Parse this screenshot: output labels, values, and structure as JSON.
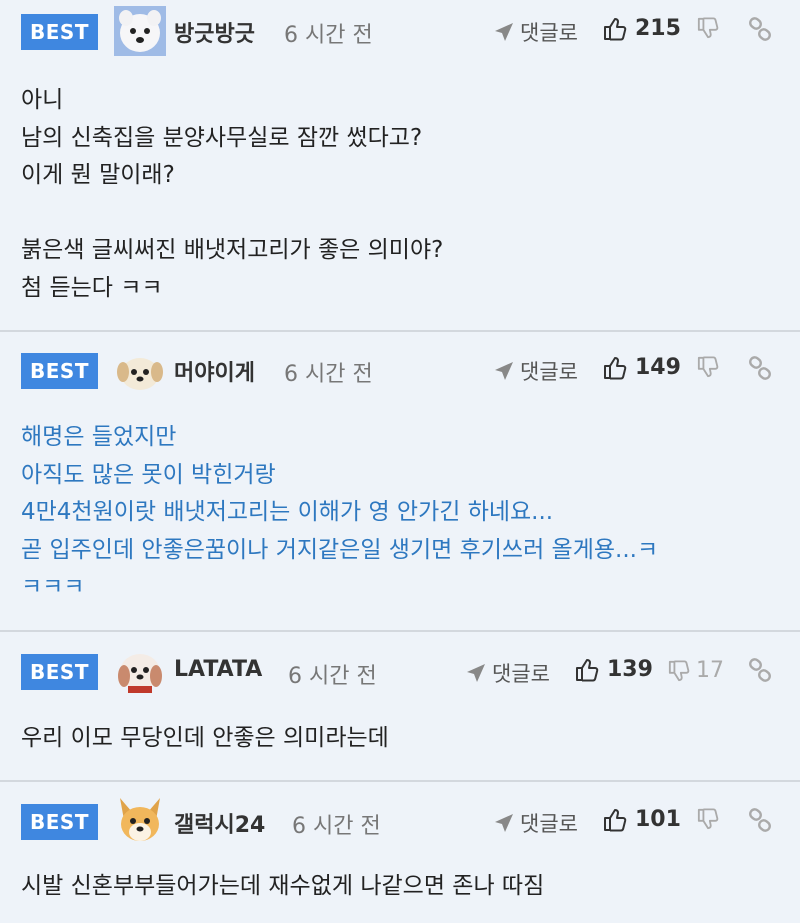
{
  "comments": [
    {
      "badge": "BEST",
      "nickname": "방긋방긋",
      "time": "6 시간 전",
      "reply_label": "댓글로",
      "likes": "215",
      "dislikes": "",
      "highlight": false,
      "avatar": "white-dog-avatar",
      "text": "아니\n남의 신축집을 분양사무실로 잠깐 썼다고?\n이게 뭔 말이래?\n\n붉은색 글씨써진 배냇저고리가 좋은 의미야?\n첨 듣는다 ㅋㅋ"
    },
    {
      "badge": "BEST",
      "nickname": "머야이게",
      "time": "6 시간 전",
      "reply_label": "댓글로",
      "likes": "149",
      "dislikes": "",
      "highlight": true,
      "avatar": "puppy-avatar",
      "text": "해명은 들었지만\n아직도 많은 못이 박힌거랑\n4만4천원이랏 배냇저고리는 이해가 영 안가긴 하네요...\n곧 입주인데 안좋은꿈이나 거지같은일 생기면 후기쓰러 올게용...ㅋ\nㅋㅋㅋ"
    },
    {
      "badge": "BEST",
      "nickname": "LATATA",
      "time": "6 시간 전",
      "reply_label": "댓글로",
      "likes": "139",
      "dislikes": "17",
      "highlight": false,
      "avatar": "small-dog-avatar",
      "text": "우리 이모 무당인데 안좋은 의미라는데"
    },
    {
      "badge": "BEST",
      "nickname": "갤럭시24",
      "time": "6 시간 전",
      "reply_label": "댓글로",
      "likes": "101",
      "dislikes": "",
      "highlight": false,
      "avatar": "shiba-avatar",
      "text": "시발 신혼부부들어가는데 재수없게 나같으면 존나 따짐"
    }
  ],
  "colors": {
    "background": "#eef3f9",
    "badge": "#3f87e0",
    "highlight_text": "#2e78c0",
    "divider": "#d3d8de"
  }
}
